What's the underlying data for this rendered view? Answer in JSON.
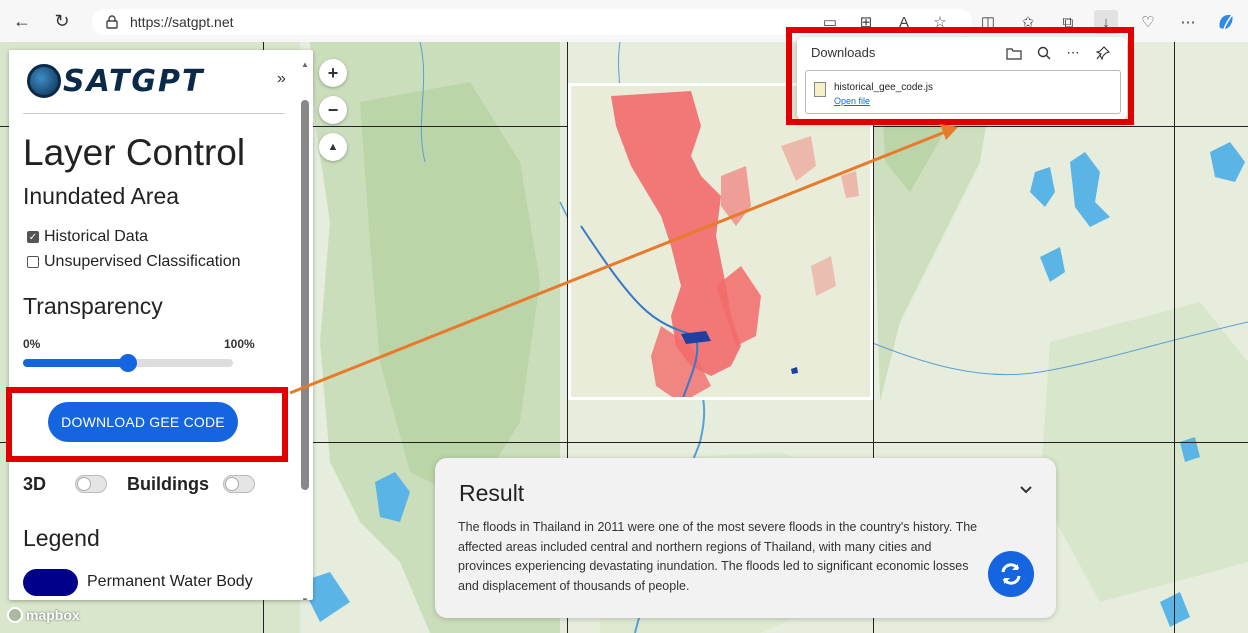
{
  "browser": {
    "url": "https://satgpt.net"
  },
  "downloads": {
    "title": "Downloads",
    "file_name": "historical_gee_code.js",
    "open_label": "Open file"
  },
  "panel": {
    "logo_text": "SATGPT",
    "collapse_icon": "»",
    "heading": "Layer Control",
    "subheading": "Inundated Area",
    "checkboxes": [
      {
        "label": "Historical Data",
        "checked": true
      },
      {
        "label": "Unsupervised Classification",
        "checked": false
      }
    ],
    "transparency": {
      "heading": "Transparency",
      "min_label": "0%",
      "max_label": "100%",
      "value": 0.5
    },
    "download_button": "DOWNLOAD GEE CODE",
    "toggles": [
      {
        "label": "3D",
        "on": false
      },
      {
        "label": "Buildings",
        "on": false
      }
    ],
    "legend": {
      "heading": "Legend",
      "items": [
        {
          "label": "Permanent Water Body",
          "color": "#00008b"
        }
      ]
    }
  },
  "map_controls": {
    "zoom_in": "+",
    "zoom_out": "−",
    "compass": "▲"
  },
  "result": {
    "title": "Result",
    "text": "The floods in Thailand in 2011 were one of the most severe floods in the country's history. The affected areas included central and northern regions of Thailand, with many cities and provinces experiencing devastating inundation. The floods led to significant economic losses and displacement of thousands of people."
  },
  "attribution": {
    "brand": "mapbox"
  },
  "colors": {
    "accent": "#1565e0",
    "annotation_red": "#e00000",
    "annotation_arrow": "#e87a2b",
    "flood": "#f26b6b",
    "water": "#5ab4e5"
  }
}
